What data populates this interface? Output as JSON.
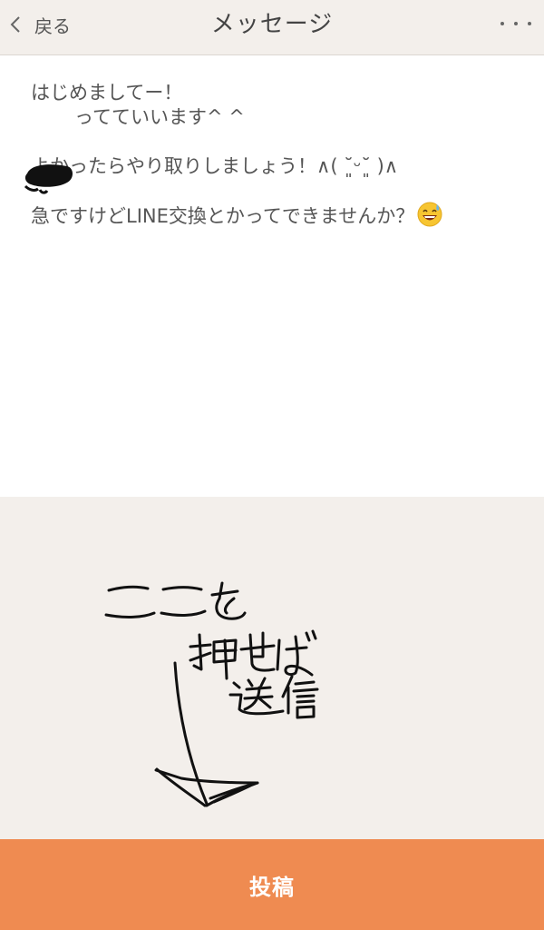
{
  "header": {
    "back_label": "戻る",
    "title": "メッセージ",
    "back_icon": "chevron-left-icon",
    "more_icon": "more-horizontal-icon"
  },
  "message": {
    "lines": [
      "はじめましてー！",
      "ってていいます^ ^",
      "よかったらやり取りしましょう！∧( ˘͈ᵕ˘͈ )∧",
      "急ですけどLINE交換とかってできませんか？"
    ],
    "emoji": "grinning-face-with-sweat-icon"
  },
  "annotation": {
    "handwritten_lines": [
      "ここを",
      "押せば",
      "送信"
    ]
  },
  "footer": {
    "post_label": "投稿"
  },
  "colors": {
    "header_bg": "#f3efeb",
    "draft_bg": "#f3efeb",
    "accent": "#ef8b51",
    "text": "#555555"
  }
}
